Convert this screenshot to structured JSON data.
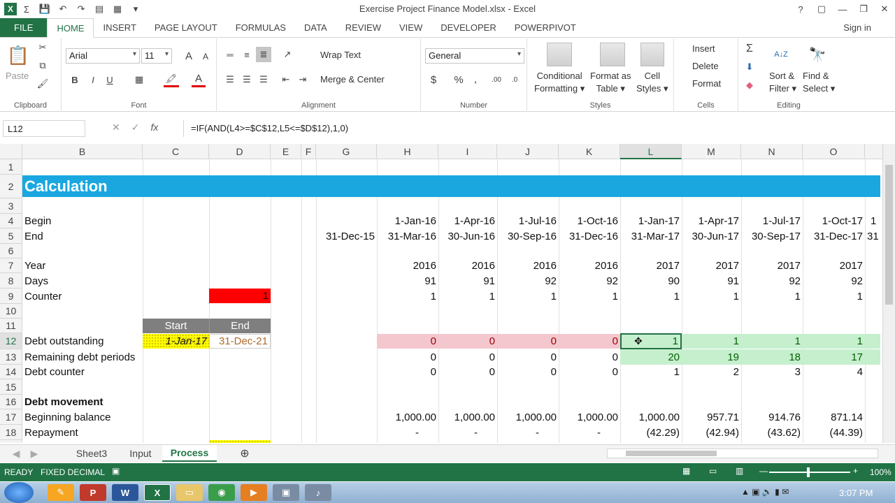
{
  "window": {
    "title": "Exercise Project Finance Model.xlsx - Excel",
    "controls": {
      "help": "?",
      "ribbon_display": "▢",
      "minimize": "—",
      "restore": "❐",
      "close": "✕"
    }
  },
  "qat": {
    "logo": "X",
    "autosum": "Σ",
    "save": "💾",
    "undo": "↶",
    "redo": "↷",
    "form": "▤",
    "layout": "▦",
    "more": "▾"
  },
  "tabs": [
    "FILE",
    "HOME",
    "INSERT",
    "PAGE LAYOUT",
    "FORMULAS",
    "DATA",
    "REVIEW",
    "VIEW",
    "DEVELOPER",
    "POWERPIVOT"
  ],
  "active_tab": "HOME",
  "signin": "Sign in",
  "ribbon": {
    "clipboard": {
      "label": "Clipboard",
      "paste": "Paste",
      "paste_icon": "📋",
      "cut": "✂",
      "copy": "⧉",
      "painter": "🖌"
    },
    "font": {
      "label": "Font",
      "family": "Arial",
      "size": "11",
      "grow": "A",
      "shrink": "A",
      "bold": "B",
      "italic": "I",
      "underline": "U",
      "border": "▦",
      "fill": "🖍",
      "color": "A"
    },
    "alignment": {
      "label": "Alignment",
      "wrap": "Wrap Text",
      "merge": "Merge & Center",
      "align_top": "═",
      "align_mid": "≡",
      "align_bot": "≣",
      "orient": "↗",
      "left": "☰",
      "center": "☰",
      "right": "☰",
      "dec_indent": "⇤",
      "inc_indent": "⇥"
    },
    "number": {
      "label": "Number",
      "format": "General",
      "currency": "$",
      "percent": "%",
      "comma": ",",
      "inc_dec": ".00",
      "dec_dec": ".0"
    },
    "styles": {
      "label": "Styles",
      "conditional": [
        "Conditional",
        "Formatting ▾"
      ],
      "table": [
        "Format as",
        "Table ▾"
      ],
      "cell": [
        "Cell",
        "Styles ▾"
      ]
    },
    "cells": {
      "label": "Cells",
      "insert": "Insert",
      "delete": "Delete",
      "format": "Format"
    },
    "editing": {
      "label": "Editing",
      "sum": "Σ",
      "fill": "⬇",
      "clear": "◆",
      "sort": [
        "Sort &",
        "Filter ▾"
      ],
      "find": [
        "Find &",
        "Select ▾"
      ],
      "sort_icon": "A↓Z",
      "find_icon": "🔭"
    }
  },
  "formula_bar": {
    "name_box": "L12",
    "cancel": "✕",
    "enter": "✓",
    "fx": "fx",
    "formula": "=IF(AND(L4>=$C$12,L5<=$D$12),1,0)"
  },
  "columns": [
    "B",
    "C",
    "D",
    "E",
    "F",
    "G",
    "H",
    "I",
    "J",
    "K",
    "L",
    "M",
    "N",
    "O"
  ],
  "rows": [
    "1",
    "2",
    "3",
    "4",
    "5",
    "6",
    "7",
    "8",
    "9",
    "10",
    "11",
    "12",
    "13",
    "14",
    "15",
    "16",
    "17",
    "18",
    "19"
  ],
  "sheet": {
    "title": "Calculation",
    "r4": {
      "label": "Begin",
      "values": [
        "",
        "1-Jan-16",
        "1-Apr-16",
        "1-Jul-16",
        "1-Oct-16",
        "1-Jan-17",
        "1-Apr-17",
        "1-Jul-17",
        "1-Oct-17"
      ],
      "overflow": "1"
    },
    "r5": {
      "label": "End",
      "values": [
        "31-Dec-15",
        "31-Mar-16",
        "30-Jun-16",
        "30-Sep-16",
        "31-Dec-16",
        "31-Mar-17",
        "30-Jun-17",
        "30-Sep-17",
        "31-Dec-17"
      ],
      "overflow": "31"
    },
    "r7": {
      "label": "Year",
      "values": [
        "",
        "2016",
        "2016",
        "2016",
        "2016",
        "2017",
        "2017",
        "2017",
        "2017"
      ]
    },
    "r8": {
      "label": "Days",
      "values": [
        "",
        "91",
        "91",
        "92",
        "92",
        "90",
        "91",
        "92",
        "92"
      ]
    },
    "r9": {
      "label": "Counter",
      "d_value": "1",
      "values": [
        "",
        "1",
        "1",
        "1",
        "1",
        "1",
        "1",
        "1",
        "1"
      ]
    },
    "r11": {
      "start": "Start",
      "end": "End"
    },
    "r12": {
      "label": "Debt outstanding",
      "c_value": "1-Jan-17",
      "d_value": "31-Dec-21",
      "values": [
        "",
        "0",
        "0",
        "0",
        "0",
        "1",
        "1",
        "1",
        "1"
      ]
    },
    "r13": {
      "label": "Remaining debt periods",
      "values": [
        "",
        "0",
        "0",
        "0",
        "0",
        "20",
        "19",
        "18",
        "17"
      ]
    },
    "r14": {
      "label": "Debt counter",
      "values": [
        "",
        "0",
        "0",
        "0",
        "0",
        "1",
        "2",
        "3",
        "4"
      ]
    },
    "r16": {
      "label": "Debt movement"
    },
    "r17": {
      "label": "Beginning balance",
      "values": [
        "",
        "1,000.00",
        "1,000.00",
        "1,000.00",
        "1,000.00",
        "1,000.00",
        "957.71",
        "914.76",
        "871.14"
      ]
    },
    "r18": {
      "label": "Repayment",
      "values": [
        "",
        "-",
        "-",
        "-",
        "-",
        "(42.29)",
        "(42.94)",
        "(43.62)",
        "(44.39)"
      ]
    }
  },
  "sheet_tabs": [
    "Sheet3",
    "Input",
    "Process"
  ],
  "active_sheet": "Process",
  "status": {
    "ready": "READY",
    "fixed": "FIXED DECIMAL",
    "zoom": "100%"
  },
  "taskbar": {
    "time": "3:07 PM",
    "apps": [
      "W",
      "X",
      "P"
    ]
  },
  "colors": {
    "excel_green": "#217346",
    "title_blue": "#1aa7e0",
    "pink": "#f4c7ce",
    "light_green": "#c6efce",
    "red": "#ff0000",
    "yellow": "#ffff00",
    "header_gray": "#7f7f7f"
  }
}
